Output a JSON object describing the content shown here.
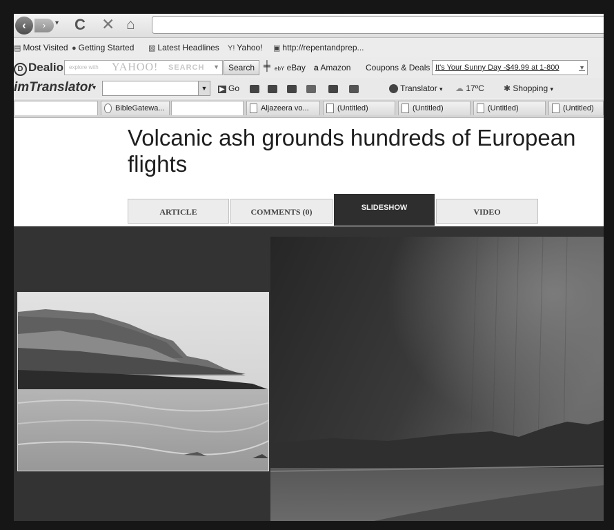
{
  "browser": {
    "back_icon": "‹",
    "forward_icon": "›",
    "history_dropdown_icon": "▾",
    "reload_icon": "C",
    "stop_icon": "✕",
    "home_icon": "⌂",
    "url": ""
  },
  "bookmarks": [
    {
      "label": "Most Visited",
      "icon": "▤"
    },
    {
      "label": "Getting Started",
      "icon": "●"
    },
    {
      "label": "Latest Headlines",
      "icon": "▧"
    },
    {
      "label": "Yahoo!",
      "icon": "Y!"
    },
    {
      "label": "http://repentandprep...",
      "icon": "▣"
    }
  ],
  "dealio_toolbar": {
    "logo": "Dealio",
    "search_hint": "explore with",
    "search_brand": "YAHOO!",
    "search_label": "SEARCH",
    "search_button": "Search",
    "ebay_label": "eBay",
    "amazon_label": "Amazon",
    "coupons_label": "Coupons & Deals",
    "deal_ticker": "It's Your Sunny Day -$49.99 at 1-800"
  },
  "translator_toolbar": {
    "logo": "imTranslator",
    "go_label": "Go",
    "translator_label": "Translator",
    "temperature": "17ºC",
    "shopping_label": "Shopping"
  },
  "browser_tabs": [
    {
      "label": "",
      "blank": true
    },
    {
      "label": "BibleGatewa...",
      "blank": false
    },
    {
      "label": "",
      "blank": true
    },
    {
      "label": "Aljazeera vo...",
      "blank": false
    },
    {
      "label": "(Untitled)",
      "blank": false
    },
    {
      "label": "(Untitled)",
      "blank": false
    },
    {
      "label": "(Untitled)",
      "blank": false
    },
    {
      "label": "(Untitled)",
      "blank": false
    }
  ],
  "article": {
    "headline": "Volcanic ash grounds hundreds of European flights",
    "tabs": [
      {
        "label": "ARTICLE",
        "active": false
      },
      {
        "label": "COMMENTS (0)",
        "active": false
      },
      {
        "label": "SLIDESHOW",
        "active": true
      },
      {
        "label": "VIDEO",
        "active": false
      }
    ]
  },
  "colors": {
    "page_bg": "#ffffff",
    "slideshow_bg": "#333333",
    "active_tab_bg": "#2e2e2e",
    "border": "#161616"
  }
}
